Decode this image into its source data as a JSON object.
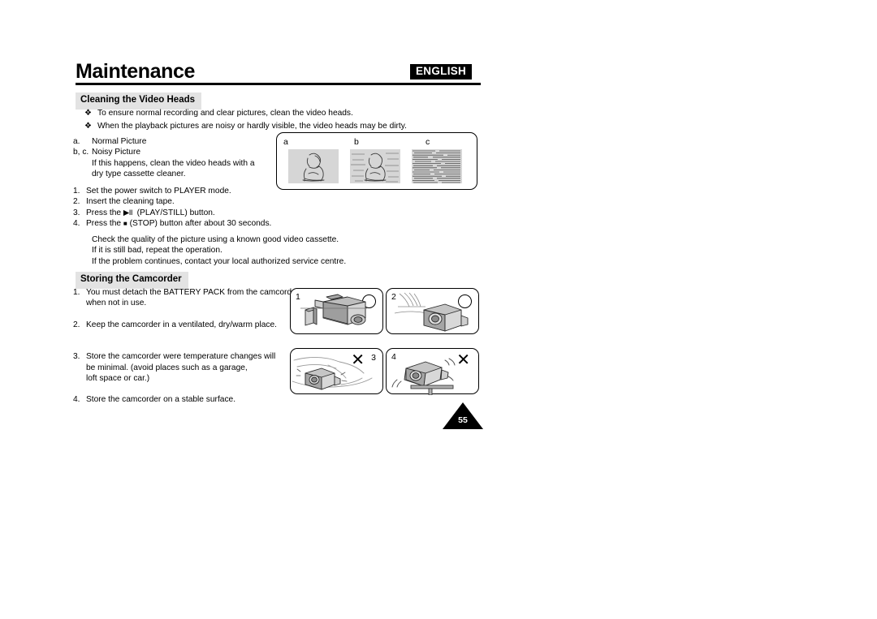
{
  "header": {
    "title": "Maintenance",
    "language_badge": "ENGLISH"
  },
  "sections": {
    "cleaning": {
      "heading": "Cleaning the Video Heads",
      "bullets": [
        "To ensure normal recording and clear pictures, clean the video heads.",
        "When the playback pictures are noisy or hardly visible, the video heads may be dirty."
      ],
      "bullet_glyph": "❖",
      "picture_legend": [
        {
          "label": "a.",
          "text": "Normal Picture"
        },
        {
          "label": "b, c.",
          "text": "Noisy Picture"
        }
      ],
      "picture_legend_sub": [
        "If this happens, clean the video heads with a",
        "dry type cassette cleaner."
      ],
      "steps": [
        {
          "num": "1.",
          "text": "Set the power switch to PLAYER mode."
        },
        {
          "num": "2.",
          "text": "Insert the cleaning tape."
        },
        {
          "num": "3.",
          "pre": "Press the",
          "glyph": "▶II",
          "post": "(PLAY/STILL) button."
        },
        {
          "num": "4.",
          "pre": "Press the",
          "glyph": "■",
          "post": "(STOP) button after about 30 seconds."
        }
      ],
      "notes": [
        "Check the quality of the picture using a known good video cassette.",
        "If it is still bad, repeat the operation.",
        "If the problem continues, contact your local authorized service centre."
      ]
    },
    "storing": {
      "heading": "Storing the Camcorder",
      "items": [
        {
          "num": "1.",
          "lines": [
            "You must detach the BATTERY PACK from the camcorder",
            "when not in use."
          ]
        },
        {
          "num": "2.",
          "lines": [
            "Keep the camcorder in a ventilated, dry/warm place."
          ]
        },
        {
          "num": "3.",
          "lines": [
            "Store the camcorder were temperature changes will",
            "be minimal. (avoid places such as a garage,",
            "loft space or car.)"
          ]
        },
        {
          "num": "4.",
          "lines": [
            "Store the camcorder on a stable surface."
          ]
        }
      ]
    }
  },
  "illustrations": {
    "picture_quality": {
      "cells": [
        {
          "label": "a",
          "kind": "normal"
        },
        {
          "label": "b",
          "kind": "noisy"
        },
        {
          "label": "c",
          "kind": "static"
        }
      ]
    },
    "storing_panels": [
      {
        "label": "1",
        "mark": "circle",
        "caption_icon": "camcorder-with-detached-battery"
      },
      {
        "label": "2",
        "mark": "circle",
        "caption_icon": "camcorder-in-ventilated-place"
      },
      {
        "label": "3",
        "mark": "x",
        "caption_icon": "camcorder-in-car"
      },
      {
        "label": "4",
        "mark": "x",
        "caption_icon": "camcorder-on-unstable-table"
      }
    ],
    "x_glyph": "✕"
  },
  "footer": {
    "page_number": "55"
  }
}
